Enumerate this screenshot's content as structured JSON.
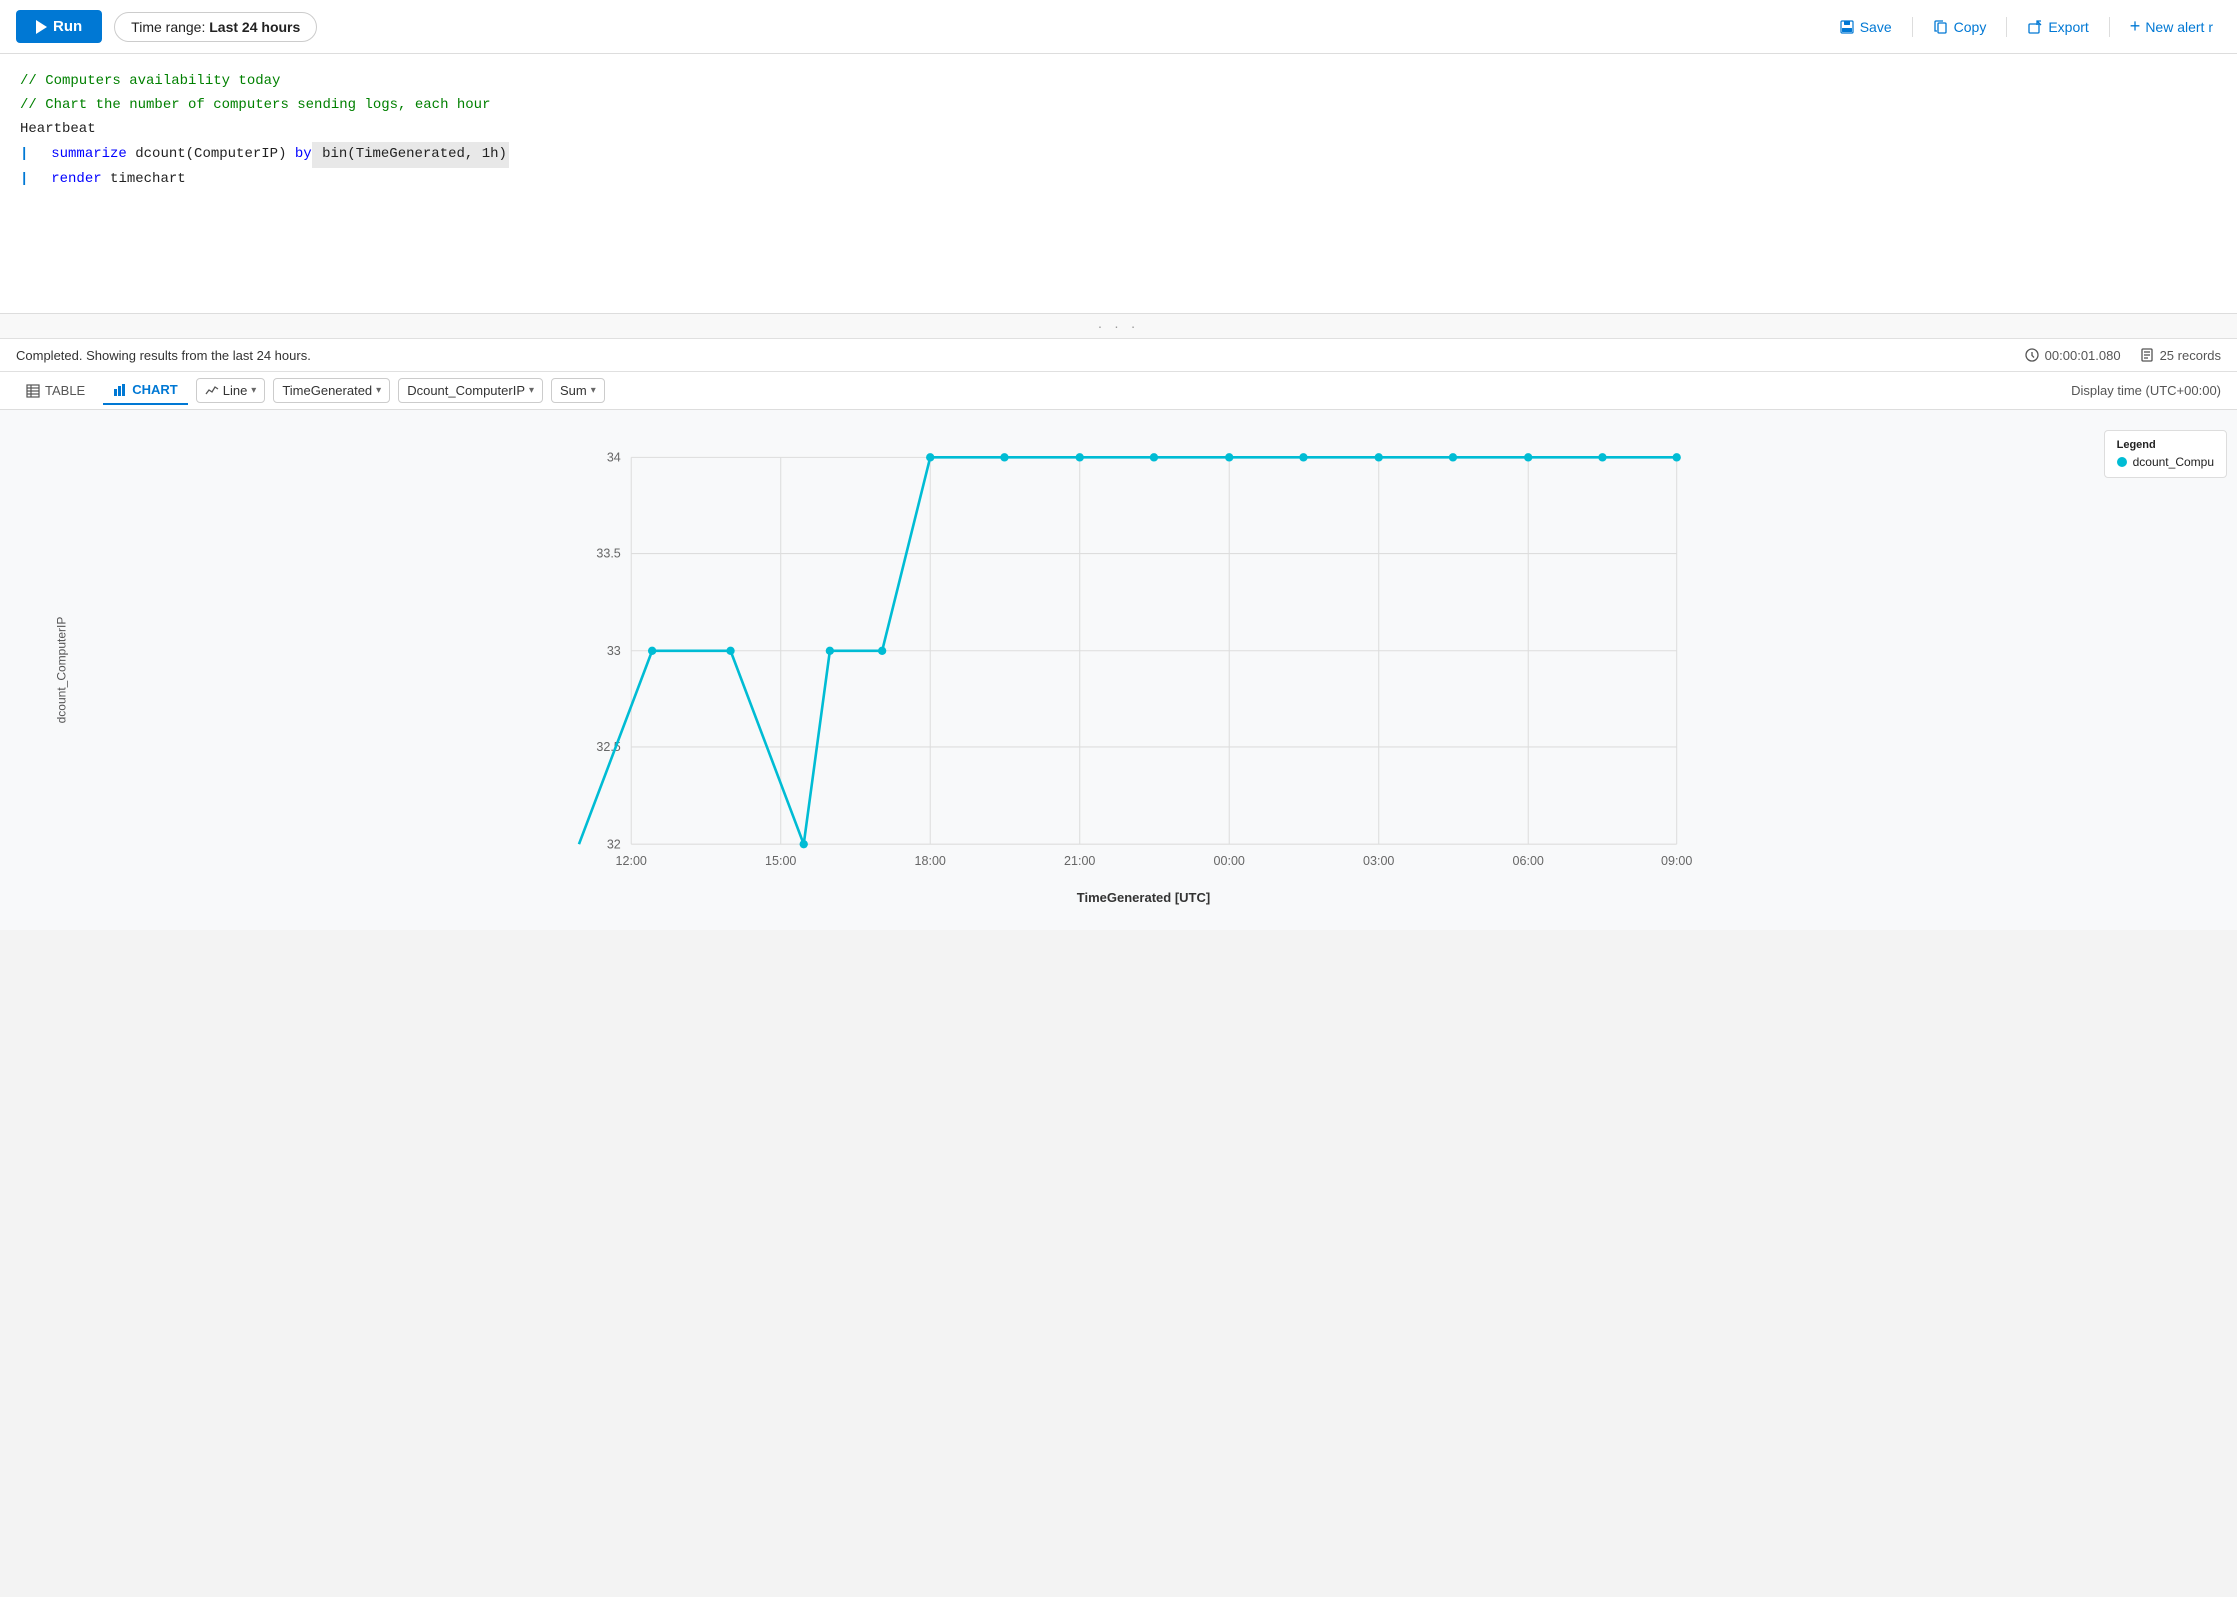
{
  "toolbar": {
    "run_label": "Run",
    "time_range_label": "Time range:",
    "time_range_value": "Last 24 hours",
    "save_label": "Save",
    "copy_label": "Copy",
    "export_label": "Export",
    "new_alert_label": "New alert r"
  },
  "editor": {
    "line1": "// Computers availability today",
    "line2": "// Chart the number of computers sending logs, each hour",
    "line3": "Heartbeat",
    "line4_pipe": "|",
    "line4_kw": "summarize",
    "line4_rest": " dcount(ComputerIP) ",
    "line4_by": "by",
    "line4_end": " bin(TimeGenerated, 1h)",
    "line5_pipe": "|",
    "line5_kw": "render",
    "line5_rest": " timechart"
  },
  "results": {
    "status_text": "Completed. Showing results from the last 24 hours.",
    "duration": "00:00:01.080",
    "records": "25 records"
  },
  "tabs": {
    "table_label": "TABLE",
    "chart_label": "CHART",
    "active": "CHART"
  },
  "chart_controls": {
    "type_label": "Line",
    "x_axis_label": "TimeGenerated",
    "y_axis_label": "Dcount_ComputerIP",
    "aggregation_label": "Sum",
    "display_time": "Display time (UTC+00:00)"
  },
  "chart": {
    "y_axis_title": "dcount_ComputerIP",
    "x_axis_title": "TimeGenerated [UTC]",
    "y_min": 32,
    "y_max": 34,
    "x_labels": [
      "12:00",
      "15:00",
      "18:00",
      "21:00",
      "00:00",
      "03:00",
      "06:00",
      "09:00"
    ],
    "legend_label": "dcount_Compu",
    "legend_color": "#00bcd4"
  },
  "icons": {
    "play": "▶",
    "save": "💾",
    "copy": "🔗",
    "export": "↗",
    "new_alert": "+",
    "clock": "⏱",
    "records": "📋",
    "table_icon": "≡",
    "chart_icon": "📊",
    "line_icon": "~"
  }
}
